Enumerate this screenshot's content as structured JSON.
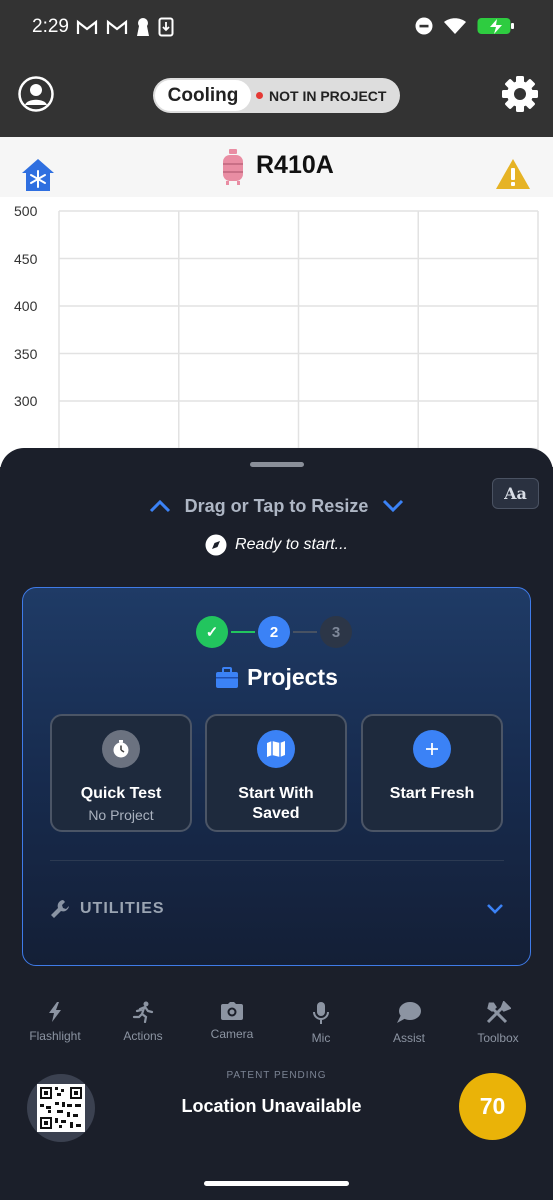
{
  "status_bar": {
    "time": "2:29",
    "left_icons": [
      "gmail-icon",
      "gmail-icon",
      "keyhole-icon",
      "download-icon"
    ],
    "right_icons": [
      "dnd-icon",
      "wifi-icon",
      "battery-charging-icon"
    ]
  },
  "header": {
    "mode": "Cooling",
    "project_status": "NOT IN PROJECT",
    "status_dot_color": "#e53935"
  },
  "refrigerant": {
    "name": "R410A",
    "tank_color": "#e98da3",
    "warning_color": "#e6b325"
  },
  "chart_data": {
    "type": "line",
    "y_ticks": [
      "500",
      "450",
      "400",
      "350",
      "300"
    ],
    "ylim": [
      250,
      500
    ],
    "grid": true,
    "series": []
  },
  "sheet": {
    "resize_label": "Drag or Tap to Resize",
    "font_button": "Aa",
    "ready_text": "Ready to start...",
    "stepper": {
      "steps": [
        "✓",
        "2",
        "3"
      ],
      "current_step": 2
    },
    "section_title": "Projects",
    "options": [
      {
        "title": "Quick Test",
        "subtitle": "No Project",
        "icon": "stopwatch-icon"
      },
      {
        "title": "Start With Saved",
        "subtitle": "",
        "icon": "map-icon"
      },
      {
        "title": "Start Fresh",
        "subtitle": "",
        "icon": "plus-icon"
      }
    ],
    "utilities_label": "UTILITIES"
  },
  "toolbar": {
    "items": [
      {
        "label": "Flashlight",
        "icon": "flashlight-icon"
      },
      {
        "label": "Actions",
        "icon": "running-person-icon"
      },
      {
        "label": "Camera",
        "icon": "camera-icon"
      },
      {
        "label": "Mic",
        "icon": "mic-icon"
      },
      {
        "label": "Assist",
        "icon": "chat-bubble-icon"
      },
      {
        "label": "Toolbox",
        "icon": "tools-icon"
      }
    ]
  },
  "footer": {
    "patent": "PATENT PENDING",
    "location": "Location Unavailable",
    "score": "70"
  },
  "colors": {
    "accent_blue": "#3b82f6",
    "success_green": "#22c55e",
    "score_yellow": "#eab308"
  }
}
